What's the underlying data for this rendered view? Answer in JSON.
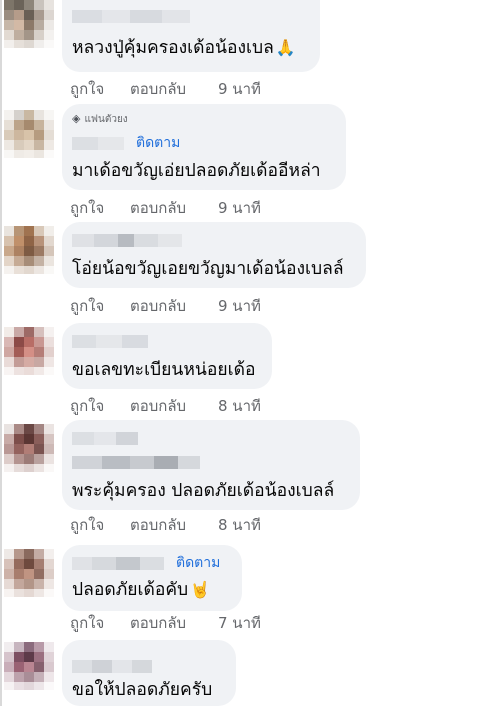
{
  "actions": {
    "like_label": "ถูกใจ",
    "reply_label": "ตอบกลับ"
  },
  "comments": [
    {
      "text": "หลวงปู่คุ้มครองเด้อน้องเบล",
      "emoji": "pray-emoji",
      "time": "9 นาที"
    },
    {
      "badge": "แฟนตัวยง",
      "badge_icon": "gem-icon",
      "follow_label": "ติดตาม",
      "text": "มาเด้อขวัญเอ่ยปลอดภัยเด้ออีหล่า",
      "time": "9 นาที"
    },
    {
      "text": "โอ่ยน้อขวัญเอยขวัญมาเด้อน้องเบลล์",
      "time": "9 นาที"
    },
    {
      "text": "ขอเลขทะเบียนหน่อยเด้อ",
      "time": "8 นาที"
    },
    {
      "text": "พระคุ้มครอง ปลอดภัยเด้อน้องเบลล์",
      "time": "8 นาที"
    },
    {
      "follow_label": "ติดตาม",
      "text": "ปลอดภัยเด้อคับ",
      "emoji": "horns-emoji",
      "time": "7 นาที"
    },
    {
      "text": "ขอให้ปลอดภัยครับ"
    }
  ],
  "colors": {
    "bubble_bg": "#f0f2f5",
    "link_blue": "#216fdb",
    "meta_gray": "#65676b",
    "text": "#050505"
  }
}
